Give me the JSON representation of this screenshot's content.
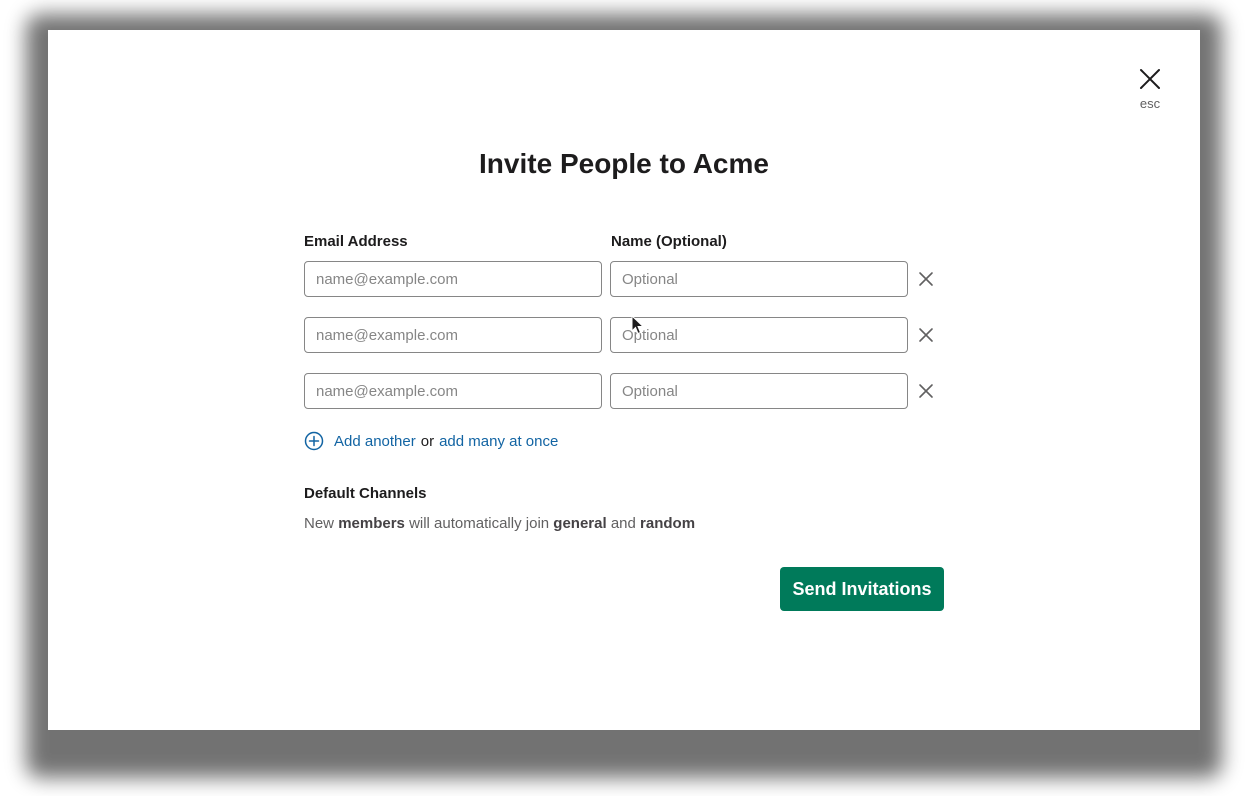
{
  "modal": {
    "close_hint": "esc",
    "title": "Invite People to Acme"
  },
  "form": {
    "email_label": "Email Address",
    "name_label": "Name (Optional)",
    "rows": [
      {
        "email_value": "",
        "email_placeholder": "name@example.com",
        "name_value": "",
        "name_placeholder": "Optional"
      },
      {
        "email_value": "",
        "email_placeholder": "name@example.com",
        "name_value": "",
        "name_placeholder": "Optional"
      },
      {
        "email_value": "",
        "email_placeholder": "name@example.com",
        "name_value": "",
        "name_placeholder": "Optional"
      }
    ],
    "add_another": "Add another",
    "or": "or",
    "add_many": "add many at once"
  },
  "channels": {
    "title": "Default Channels",
    "prefix": "New",
    "members": "members",
    "middle": "will automatically join",
    "channel_1": "general",
    "and": "and",
    "channel_2": "random"
  },
  "actions": {
    "send_label": "Send Invitations"
  },
  "colors": {
    "primary_button": "#007a5a",
    "link": "#1264a3"
  },
  "icons": {
    "close": "close-icon",
    "remove": "close-icon",
    "add": "plus-circle-icon",
    "cursor": "mouse-pointer-icon"
  }
}
